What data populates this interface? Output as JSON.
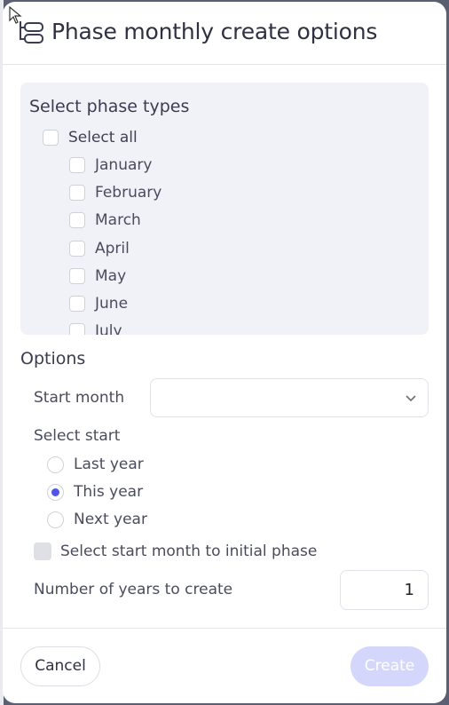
{
  "dialog": {
    "title": "Phase monthly create options",
    "title_icon": "phase-layers-icon"
  },
  "phase_types": {
    "heading": "Select phase types",
    "select_all": "Select all",
    "months": [
      "January",
      "February",
      "March",
      "April",
      "May",
      "June",
      "July"
    ]
  },
  "options": {
    "heading": "Options",
    "start_month_label": "Start month",
    "start_month_value": "",
    "select_start_label": "Select start",
    "radios": [
      {
        "label": "Last year",
        "checked": false
      },
      {
        "label": "This year",
        "checked": true
      },
      {
        "label": "Next year",
        "checked": false
      }
    ],
    "initial_phase_label": "Select start month to initial phase",
    "years_label": "Number of years to create",
    "years_value": "1"
  },
  "footer": {
    "cancel": "Cancel",
    "create": "Create"
  },
  "colors": {
    "accent": "#4f55e6",
    "create_disabled": "#d5d6fb",
    "panel_bg": "#f1f2f8"
  }
}
